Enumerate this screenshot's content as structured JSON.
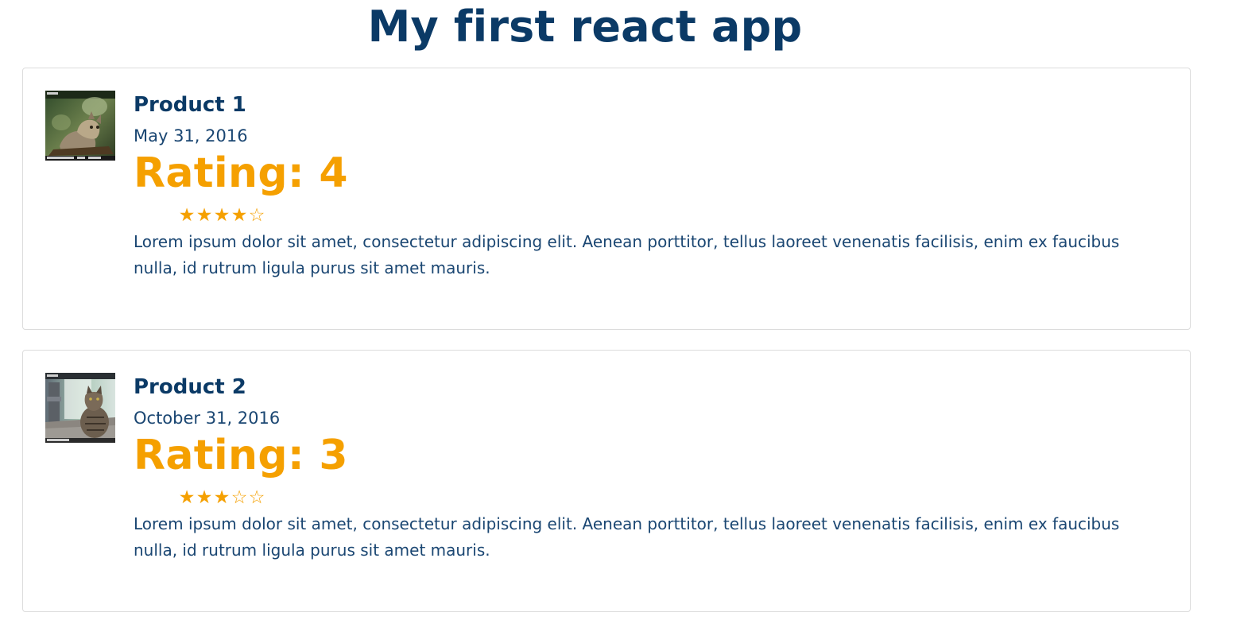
{
  "app": {
    "title": "My first react app"
  },
  "colors": {
    "heading": "#0b3a66",
    "text": "#1a4672",
    "rating": "#f5a000",
    "card_border": "#dcdcdc"
  },
  "products": [
    {
      "name": "Product 1",
      "date": "May 31, 2016",
      "rating_text": "Rating: 4",
      "rating": 4,
      "max_rating": 5,
      "stars": [
        "★",
        "★",
        "★",
        "★",
        "☆"
      ],
      "image_icon": "wildcat-photo",
      "description": "Lorem ipsum dolor sit amet, consectetur adipiscing elit. Aenean porttitor, tellus laoreet venenatis facilisis, enim ex faucibus nulla, id rutrum ligula purus sit amet mauris."
    },
    {
      "name": "Product 2",
      "date": "October 31, 2016",
      "rating_text": "Rating: 3",
      "rating": 3,
      "max_rating": 5,
      "stars": [
        "★",
        "★",
        "★",
        "☆",
        "☆"
      ],
      "image_icon": "tabby-cat-photo",
      "description": "Lorem ipsum dolor sit amet, consectetur adipiscing elit. Aenean porttitor, tellus laoreet venenatis facilisis, enim ex faucibus nulla, id rutrum ligula purus sit amet mauris."
    }
  ]
}
